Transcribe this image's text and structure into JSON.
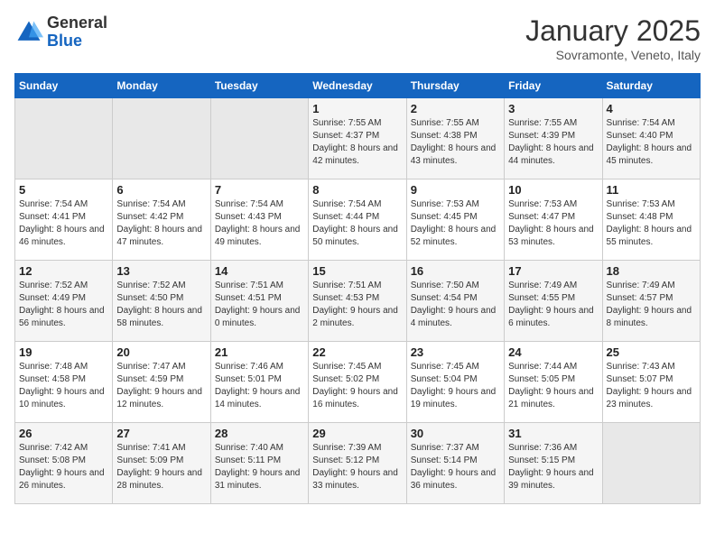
{
  "header": {
    "logo_line1": "General",
    "logo_line2": "Blue",
    "month": "January 2025",
    "location": "Sovramonte, Veneto, Italy"
  },
  "weekdays": [
    "Sunday",
    "Monday",
    "Tuesday",
    "Wednesday",
    "Thursday",
    "Friday",
    "Saturday"
  ],
  "weeks": [
    [
      {
        "day": "",
        "empty": true
      },
      {
        "day": "",
        "empty": true
      },
      {
        "day": "",
        "empty": true
      },
      {
        "day": "1",
        "sunrise": "7:55 AM",
        "sunset": "4:37 PM",
        "daylight": "8 hours and 42 minutes."
      },
      {
        "day": "2",
        "sunrise": "7:55 AM",
        "sunset": "4:38 PM",
        "daylight": "8 hours and 43 minutes."
      },
      {
        "day": "3",
        "sunrise": "7:55 AM",
        "sunset": "4:39 PM",
        "daylight": "8 hours and 44 minutes."
      },
      {
        "day": "4",
        "sunrise": "7:54 AM",
        "sunset": "4:40 PM",
        "daylight": "8 hours and 45 minutes."
      }
    ],
    [
      {
        "day": "5",
        "sunrise": "7:54 AM",
        "sunset": "4:41 PM",
        "daylight": "8 hours and 46 minutes."
      },
      {
        "day": "6",
        "sunrise": "7:54 AM",
        "sunset": "4:42 PM",
        "daylight": "8 hours and 47 minutes."
      },
      {
        "day": "7",
        "sunrise": "7:54 AM",
        "sunset": "4:43 PM",
        "daylight": "8 hours and 49 minutes."
      },
      {
        "day": "8",
        "sunrise": "7:54 AM",
        "sunset": "4:44 PM",
        "daylight": "8 hours and 50 minutes."
      },
      {
        "day": "9",
        "sunrise": "7:53 AM",
        "sunset": "4:45 PM",
        "daylight": "8 hours and 52 minutes."
      },
      {
        "day": "10",
        "sunrise": "7:53 AM",
        "sunset": "4:47 PM",
        "daylight": "8 hours and 53 minutes."
      },
      {
        "day": "11",
        "sunrise": "7:53 AM",
        "sunset": "4:48 PM",
        "daylight": "8 hours and 55 minutes."
      }
    ],
    [
      {
        "day": "12",
        "sunrise": "7:52 AM",
        "sunset": "4:49 PM",
        "daylight": "8 hours and 56 minutes."
      },
      {
        "day": "13",
        "sunrise": "7:52 AM",
        "sunset": "4:50 PM",
        "daylight": "8 hours and 58 minutes."
      },
      {
        "day": "14",
        "sunrise": "7:51 AM",
        "sunset": "4:51 PM",
        "daylight": "9 hours and 0 minutes."
      },
      {
        "day": "15",
        "sunrise": "7:51 AM",
        "sunset": "4:53 PM",
        "daylight": "9 hours and 2 minutes."
      },
      {
        "day": "16",
        "sunrise": "7:50 AM",
        "sunset": "4:54 PM",
        "daylight": "9 hours and 4 minutes."
      },
      {
        "day": "17",
        "sunrise": "7:49 AM",
        "sunset": "4:55 PM",
        "daylight": "9 hours and 6 minutes."
      },
      {
        "day": "18",
        "sunrise": "7:49 AM",
        "sunset": "4:57 PM",
        "daylight": "9 hours and 8 minutes."
      }
    ],
    [
      {
        "day": "19",
        "sunrise": "7:48 AM",
        "sunset": "4:58 PM",
        "daylight": "9 hours and 10 minutes."
      },
      {
        "day": "20",
        "sunrise": "7:47 AM",
        "sunset": "4:59 PM",
        "daylight": "9 hours and 12 minutes."
      },
      {
        "day": "21",
        "sunrise": "7:46 AM",
        "sunset": "5:01 PM",
        "daylight": "9 hours and 14 minutes."
      },
      {
        "day": "22",
        "sunrise": "7:45 AM",
        "sunset": "5:02 PM",
        "daylight": "9 hours and 16 minutes."
      },
      {
        "day": "23",
        "sunrise": "7:45 AM",
        "sunset": "5:04 PM",
        "daylight": "9 hours and 19 minutes."
      },
      {
        "day": "24",
        "sunrise": "7:44 AM",
        "sunset": "5:05 PM",
        "daylight": "9 hours and 21 minutes."
      },
      {
        "day": "25",
        "sunrise": "7:43 AM",
        "sunset": "5:07 PM",
        "daylight": "9 hours and 23 minutes."
      }
    ],
    [
      {
        "day": "26",
        "sunrise": "7:42 AM",
        "sunset": "5:08 PM",
        "daylight": "9 hours and 26 minutes."
      },
      {
        "day": "27",
        "sunrise": "7:41 AM",
        "sunset": "5:09 PM",
        "daylight": "9 hours and 28 minutes."
      },
      {
        "day": "28",
        "sunrise": "7:40 AM",
        "sunset": "5:11 PM",
        "daylight": "9 hours and 31 minutes."
      },
      {
        "day": "29",
        "sunrise": "7:39 AM",
        "sunset": "5:12 PM",
        "daylight": "9 hours and 33 minutes."
      },
      {
        "day": "30",
        "sunrise": "7:37 AM",
        "sunset": "5:14 PM",
        "daylight": "9 hours and 36 minutes."
      },
      {
        "day": "31",
        "sunrise": "7:36 AM",
        "sunset": "5:15 PM",
        "daylight": "9 hours and 39 minutes."
      },
      {
        "day": "",
        "empty": true
      }
    ]
  ]
}
